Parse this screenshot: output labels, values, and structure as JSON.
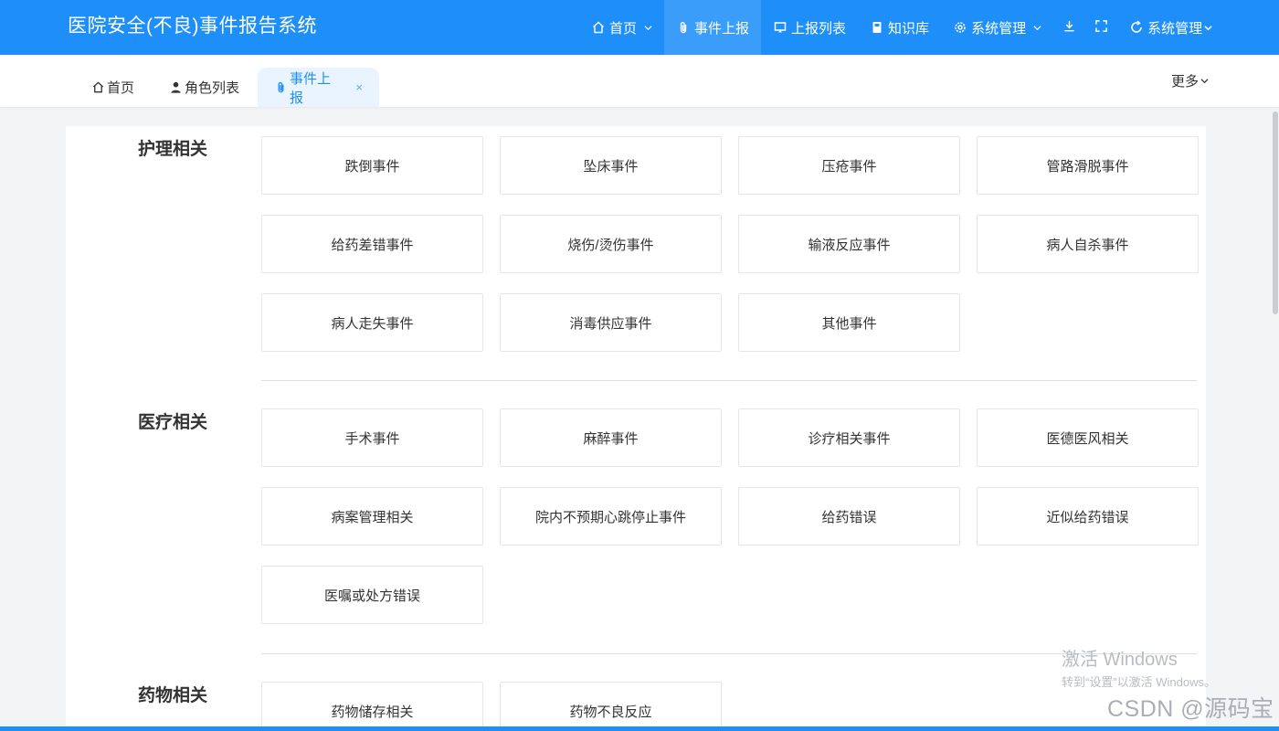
{
  "header": {
    "title": "医院安全(不良)事件报告系统",
    "nav": [
      {
        "label": "首页",
        "icon": "home-icon",
        "dropdown": true
      },
      {
        "label": "事件上报",
        "icon": "paperclip-icon",
        "dropdown": false,
        "active": true
      },
      {
        "label": "上报列表",
        "icon": "monitor-icon",
        "dropdown": false
      },
      {
        "label": "知识库",
        "icon": "book-icon",
        "dropdown": false
      },
      {
        "label": "系统管理",
        "icon": "gear-icon",
        "dropdown": true
      }
    ],
    "user_label": "系统管理",
    "accent_color": "#1e8ff8"
  },
  "tabs": [
    {
      "label": "首页",
      "icon": "home-icon"
    },
    {
      "label": "角色列表",
      "icon": "user-icon"
    },
    {
      "label": "事件上报",
      "icon": "paperclip-icon",
      "active": true,
      "close": "×"
    }
  ],
  "more_label": "更多",
  "sections": [
    {
      "title": "护理相关",
      "items": [
        "跌倒事件",
        "坠床事件",
        "压疮事件",
        "管路滑脱事件",
        "给药差错事件",
        "烧伤/烫伤事件",
        "输液反应事件",
        "病人自杀事件",
        "病人走失事件",
        "消毒供应事件",
        "其他事件"
      ]
    },
    {
      "title": "医疗相关",
      "items": [
        "手术事件",
        "麻醉事件",
        "诊疗相关事件",
        "医德医风相关",
        "病案管理相关",
        "院内不预期心跳停止事件",
        "给药错误",
        "近似给药错误",
        "医嘱或处方错误"
      ]
    },
    {
      "title": "药物相关",
      "items": [
        "药物储存相关",
        "药物不良反应"
      ]
    }
  ],
  "watermark": {
    "windows_line1": "激活 Windows",
    "windows_line2": "转到“设置”以激活 Windows。",
    "csdn": "CSDN @源码宝"
  }
}
